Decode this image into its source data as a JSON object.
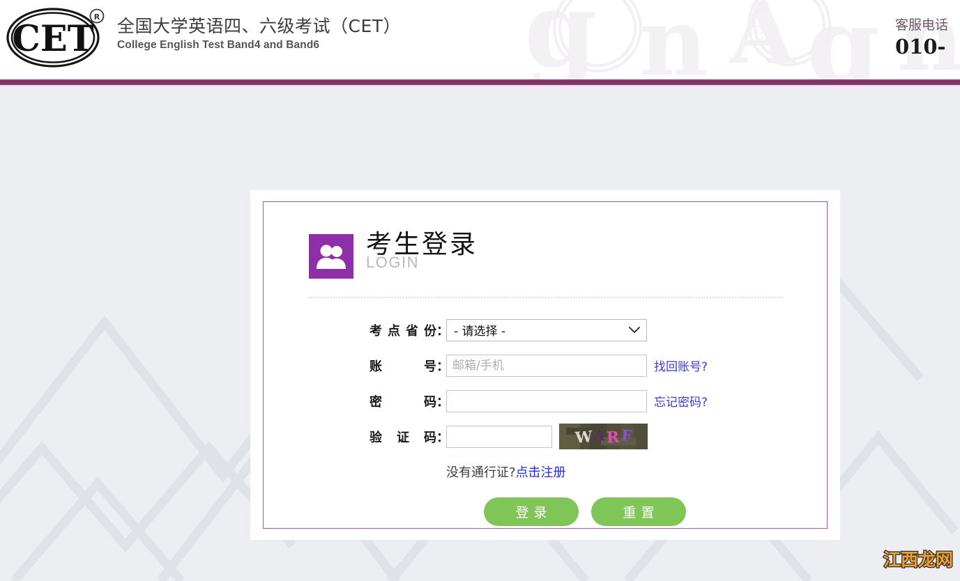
{
  "header": {
    "logo_text": "CET",
    "logo_registered_mark": "®",
    "brand_cn": "全国大学英语四、六级考试（CET）",
    "brand_en": "College English Test Band4 and Band6",
    "hotline_label": "客服电话",
    "hotline_number": "010-"
  },
  "login": {
    "icon_name": "two-users-icon",
    "title": "考生登录",
    "subtitle": "LOGIN",
    "fields": {
      "province": {
        "label": "考点省份",
        "colon": "：",
        "value": "- 请选择 -",
        "caret": "chevron-down-icon"
      },
      "account": {
        "label": "账号",
        "label_spaced": "账    号",
        "colon": "：",
        "value": "",
        "placeholder": "邮箱/手机",
        "side_link": "找回账号?"
      },
      "password": {
        "label": "密码",
        "label_spaced": "密    码",
        "colon": "：",
        "value": "",
        "placeholder": "",
        "side_link": "忘记密码?"
      },
      "captcha": {
        "label": "验证码",
        "label_spaced": "验 证 码",
        "colon": "：",
        "value": "",
        "placeholder": "",
        "image_text": "WARF",
        "letters": [
          "W",
          "A",
          "R",
          "F"
        ]
      }
    },
    "register_prompt": "没有通行证?",
    "register_link": "点击注册",
    "login_button": "登录",
    "reset_button": "重置"
  },
  "watermark": {
    "text": "江西龙网"
  },
  "colors": {
    "divider_purple": "#7e3163",
    "panel_border_purple": "#9b59b6",
    "login_icon_purple": "#8e2ea8",
    "button_green": "#80c558",
    "link_blue": "#2b2bd6",
    "page_background": "#eceef1",
    "watermark_orange": "#f0a030"
  }
}
